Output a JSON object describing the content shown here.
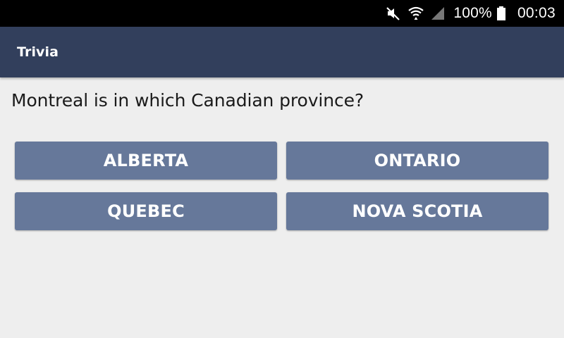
{
  "status_bar": {
    "icons": [
      "mute-icon",
      "wifi-icon",
      "signal-icon",
      "battery-icon"
    ],
    "battery_percent": "100%",
    "time": "00:03"
  },
  "app_bar": {
    "title": "Trivia",
    "color": "#323f5c"
  },
  "question": {
    "text": "Montreal is in which Canadian province?"
  },
  "answers": [
    {
      "label": "ALBERTA"
    },
    {
      "label": "ONTARIO"
    },
    {
      "label": "QUEBEC"
    },
    {
      "label": "NOVA SCOTIA"
    }
  ],
  "colors": {
    "answer_button": "#66789a",
    "background": "#eeeeee"
  }
}
